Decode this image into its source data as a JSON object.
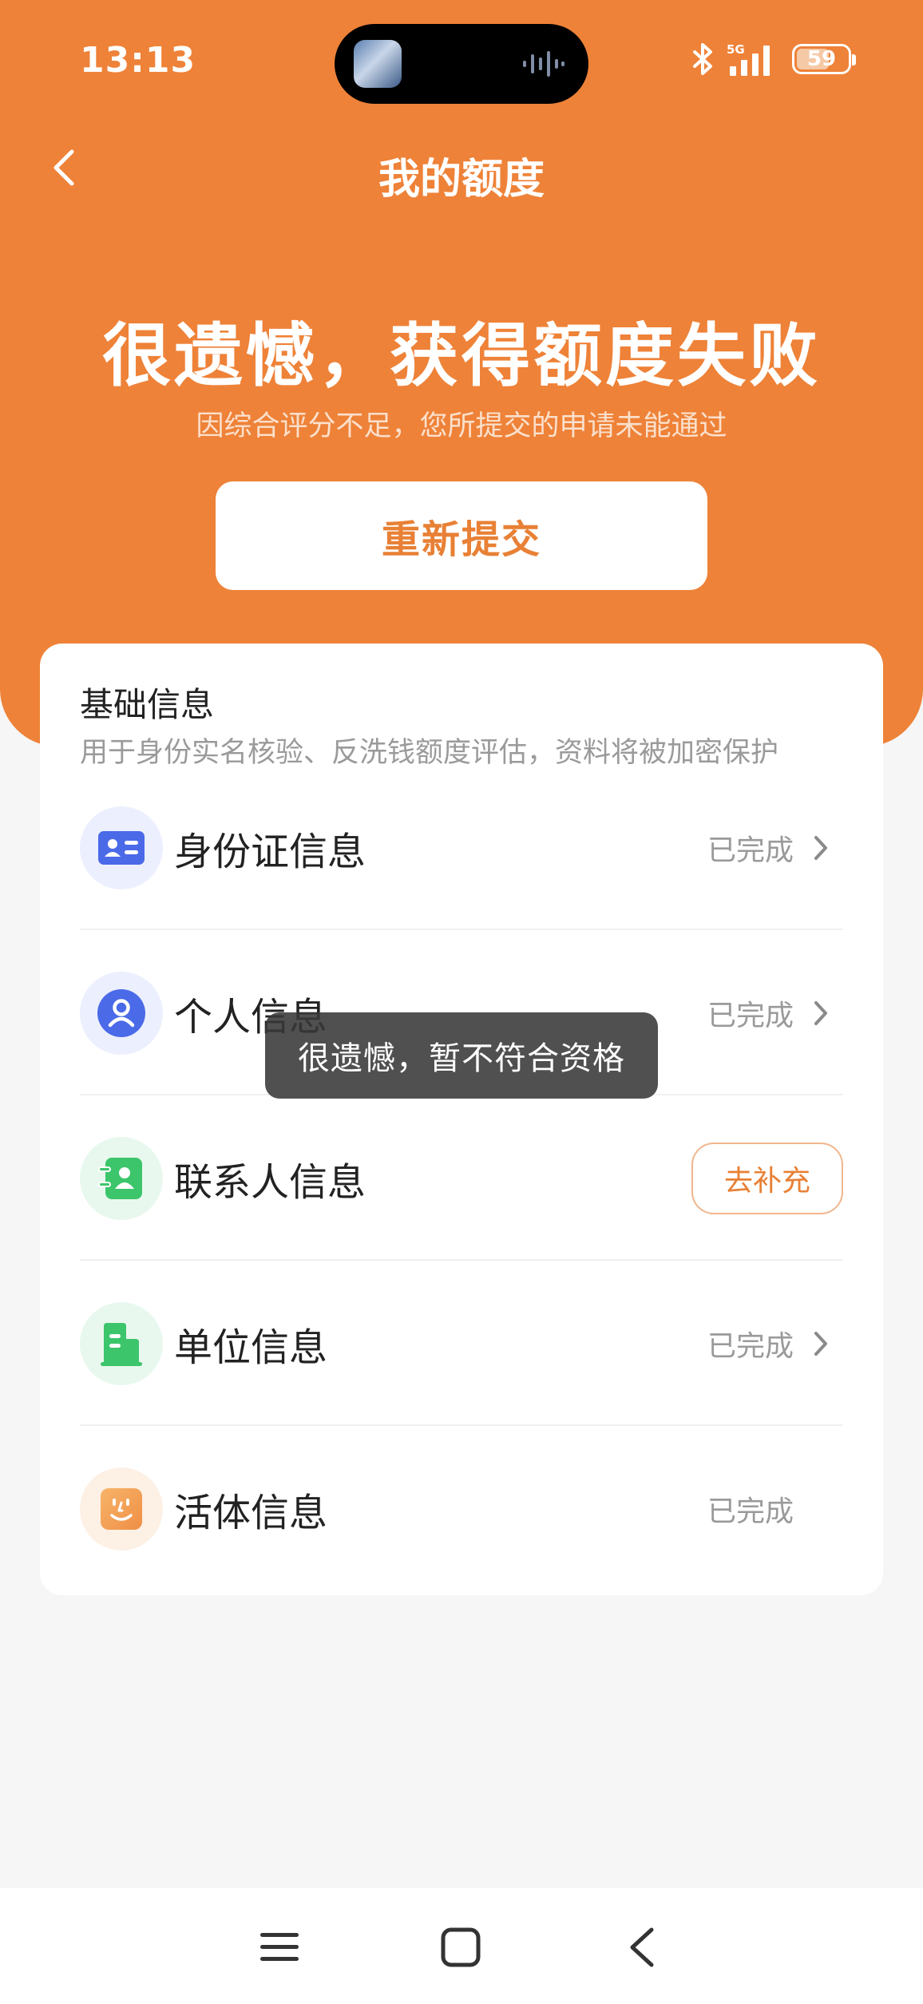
{
  "status_bar": {
    "time": "13:13",
    "network": "5G",
    "battery": "59"
  },
  "nav": {
    "title": "我的额度"
  },
  "hero": {
    "title": "很遗憾，获得额度失败",
    "subtitle": "因综合评分不足，您所提交的申请未能通过",
    "resubmit_label": "重新提交"
  },
  "card": {
    "title": "基础信息",
    "description": "用于身份实名核验、反洗钱额度评估，资料将被加密保护",
    "rows": [
      {
        "label": "身份证信息",
        "status": "已完成",
        "icon": "id-card-icon",
        "icon_bg": "#eceffd",
        "icon_color": "#4a6ae8"
      },
      {
        "label": "个人信息",
        "status": "已完成",
        "icon": "person-icon",
        "icon_bg": "#eceffd",
        "icon_color": "#4a6ae8"
      },
      {
        "label": "联系人信息",
        "action": "去补充",
        "icon": "contact-icon",
        "icon_bg": "#e8f8ee",
        "icon_color": "#3cc56b"
      },
      {
        "label": "单位信息",
        "status": "已完成",
        "icon": "building-icon",
        "icon_bg": "#e8f8ee",
        "icon_color": "#3cc56b"
      },
      {
        "label": "活体信息",
        "status": "已完成",
        "icon": "face-icon",
        "icon_bg": "#fdf0e4",
        "icon_color": "#f0a050"
      }
    ]
  },
  "toast": {
    "text": "很遗憾，暂不符合资格"
  },
  "colors": {
    "accent": "#ee8238",
    "accent_text": "#e88035"
  }
}
